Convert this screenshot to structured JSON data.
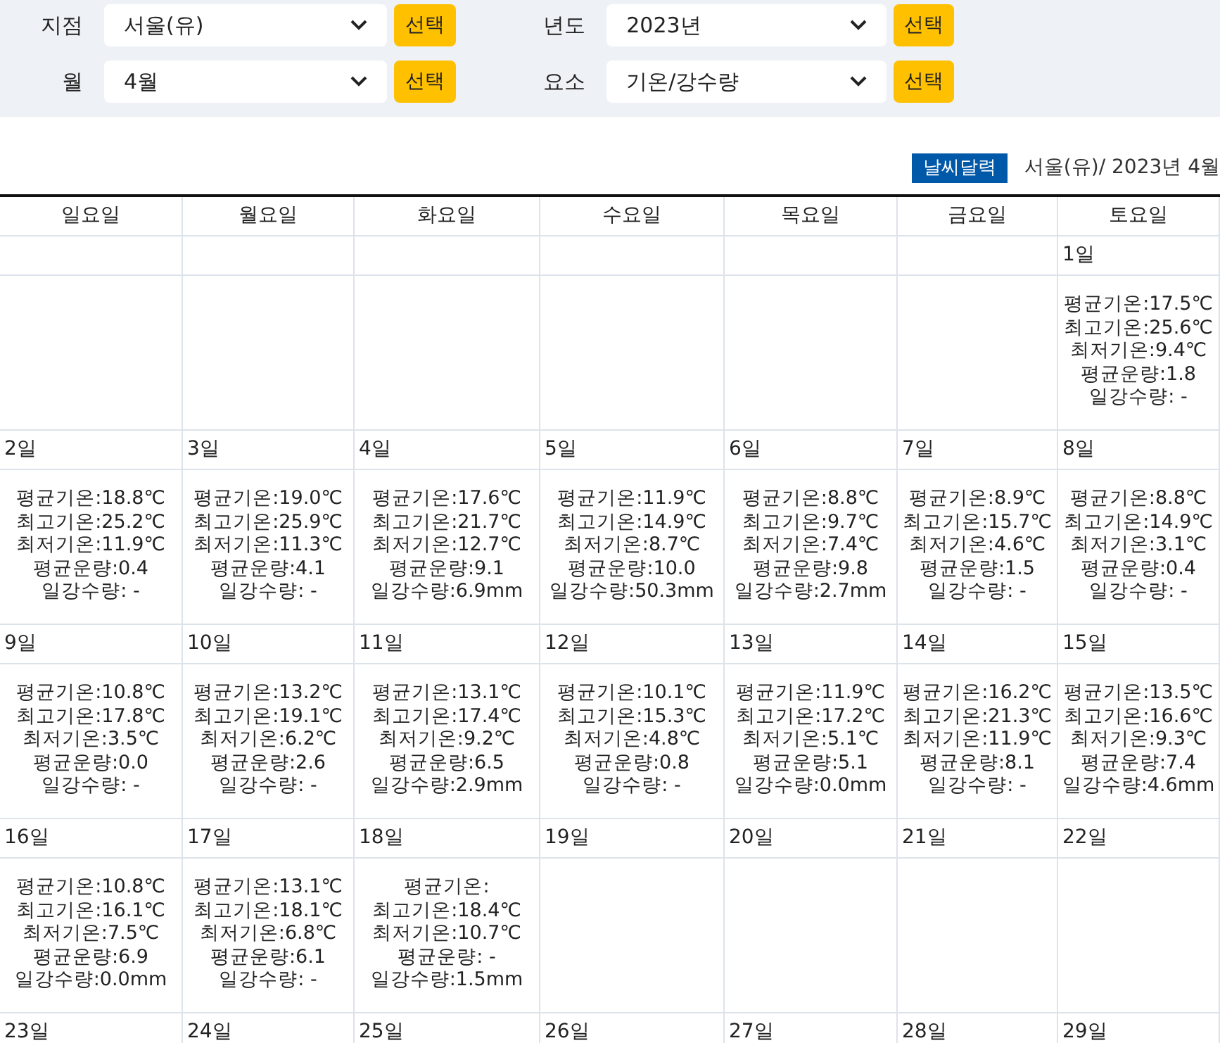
{
  "filters": [
    {
      "label": "지점",
      "value": "서울(유)",
      "button": "선택"
    },
    {
      "label": "년도",
      "value": "2023년",
      "button": "선택"
    },
    {
      "label": "월",
      "value": "4월",
      "button": "선택"
    },
    {
      "label": "요소",
      "value": "기온/강수량",
      "button": "선택"
    }
  ],
  "badge": "날씨달력",
  "caption": "서울(유)/ 2023년 4월",
  "weekdays": [
    "일요일",
    "월요일",
    "화요일",
    "수요일",
    "목요일",
    "금요일",
    "토요일"
  ],
  "weeks": [
    [
      {
        "kind": "blank"
      },
      {
        "kind": "blank"
      },
      {
        "kind": "blank"
      },
      {
        "kind": "blank"
      },
      {
        "kind": "blank"
      },
      {
        "kind": "blank"
      },
      {
        "kind": "day",
        "date": "1일",
        "lines": [
          "평균기온:17.5℃",
          "최고기온:25.6℃",
          "최저기온:9.4℃",
          "평균운량:1.8",
          "일강수량: -"
        ]
      }
    ],
    [
      {
        "kind": "day",
        "date": "2일",
        "lines": [
          "평균기온:18.8℃",
          "최고기온:25.2℃",
          "최저기온:11.9℃",
          "평균운량:0.4",
          "일강수량: -"
        ]
      },
      {
        "kind": "day",
        "date": "3일",
        "lines": [
          "평균기온:19.0℃",
          "최고기온:25.9℃",
          "최저기온:11.3℃",
          "평균운량:4.1",
          "일강수량: -"
        ]
      },
      {
        "kind": "day",
        "date": "4일",
        "lines": [
          "평균기온:17.6℃",
          "최고기온:21.7℃",
          "최저기온:12.7℃",
          "평균운량:9.1",
          "일강수량:6.9mm"
        ]
      },
      {
        "kind": "day",
        "date": "5일",
        "lines": [
          "평균기온:11.9℃",
          "최고기온:14.9℃",
          "최저기온:8.7℃",
          "평균운량:10.0",
          "일강수량:50.3mm"
        ]
      },
      {
        "kind": "day",
        "date": "6일",
        "lines": [
          "평균기온:8.8℃",
          "최고기온:9.7℃",
          "최저기온:7.4℃",
          "평균운량:9.8",
          "일강수량:2.7mm"
        ]
      },
      {
        "kind": "day",
        "date": "7일",
        "lines": [
          "평균기온:8.9℃",
          "최고기온:15.7℃",
          "최저기온:4.6℃",
          "평균운량:1.5",
          "일강수량: -"
        ]
      },
      {
        "kind": "day",
        "date": "8일",
        "lines": [
          "평균기온:8.8℃",
          "최고기온:14.9℃",
          "최저기온:3.1℃",
          "평균운량:0.4",
          "일강수량: -"
        ]
      }
    ],
    [
      {
        "kind": "day",
        "date": "9일",
        "lines": [
          "평균기온:10.8℃",
          "최고기온:17.8℃",
          "최저기온:3.5℃",
          "평균운량:0.0",
          "일강수량: -"
        ]
      },
      {
        "kind": "day",
        "date": "10일",
        "lines": [
          "평균기온:13.2℃",
          "최고기온:19.1℃",
          "최저기온:6.2℃",
          "평균운량:2.6",
          "일강수량: -"
        ]
      },
      {
        "kind": "day",
        "date": "11일",
        "lines": [
          "평균기온:13.1℃",
          "최고기온:17.4℃",
          "최저기온:9.2℃",
          "평균운량:6.5",
          "일강수량:2.9mm"
        ]
      },
      {
        "kind": "day",
        "date": "12일",
        "lines": [
          "평균기온:10.1℃",
          "최고기온:15.3℃",
          "최저기온:4.8℃",
          "평균운량:0.8",
          "일강수량: -"
        ]
      },
      {
        "kind": "day",
        "date": "13일",
        "lines": [
          "평균기온:11.9℃",
          "최고기온:17.2℃",
          "최저기온:5.1℃",
          "평균운량:5.1",
          "일강수량:0.0mm"
        ]
      },
      {
        "kind": "day",
        "date": "14일",
        "lines": [
          "평균기온:16.2℃",
          "최고기온:21.3℃",
          "최저기온:11.9℃",
          "평균운량:8.1",
          "일강수량: -"
        ]
      },
      {
        "kind": "day",
        "date": "15일",
        "lines": [
          "평균기온:13.5℃",
          "최고기온:16.6℃",
          "최저기온:9.3℃",
          "평균운량:7.4",
          "일강수량:4.6mm"
        ]
      }
    ],
    [
      {
        "kind": "day",
        "date": "16일",
        "lines": [
          "평균기온:10.8℃",
          "최고기온:16.1℃",
          "최저기온:7.5℃",
          "평균운량:6.9",
          "일강수량:0.0mm"
        ]
      },
      {
        "kind": "day",
        "date": "17일",
        "lines": [
          "평균기온:13.1℃",
          "최고기온:18.1℃",
          "최저기온:6.8℃",
          "평균운량:6.1",
          "일강수량: -"
        ]
      },
      {
        "kind": "day",
        "date": "18일",
        "lines": [
          "평균기온:",
          "최고기온:18.4℃",
          "최저기온:10.7℃",
          "평균운량: -",
          "일강수량:1.5mm"
        ]
      },
      {
        "kind": "day",
        "date": "19일"
      },
      {
        "kind": "day",
        "date": "20일"
      },
      {
        "kind": "day",
        "date": "21일"
      },
      {
        "kind": "day",
        "date": "22일"
      }
    ],
    [
      {
        "kind": "day",
        "date": "23일"
      },
      {
        "kind": "day",
        "date": "24일"
      },
      {
        "kind": "day",
        "date": "25일"
      },
      {
        "kind": "day",
        "date": "26일"
      },
      {
        "kind": "day",
        "date": "27일"
      },
      {
        "kind": "day",
        "date": "28일"
      },
      {
        "kind": "day",
        "date": "29일"
      }
    ]
  ]
}
